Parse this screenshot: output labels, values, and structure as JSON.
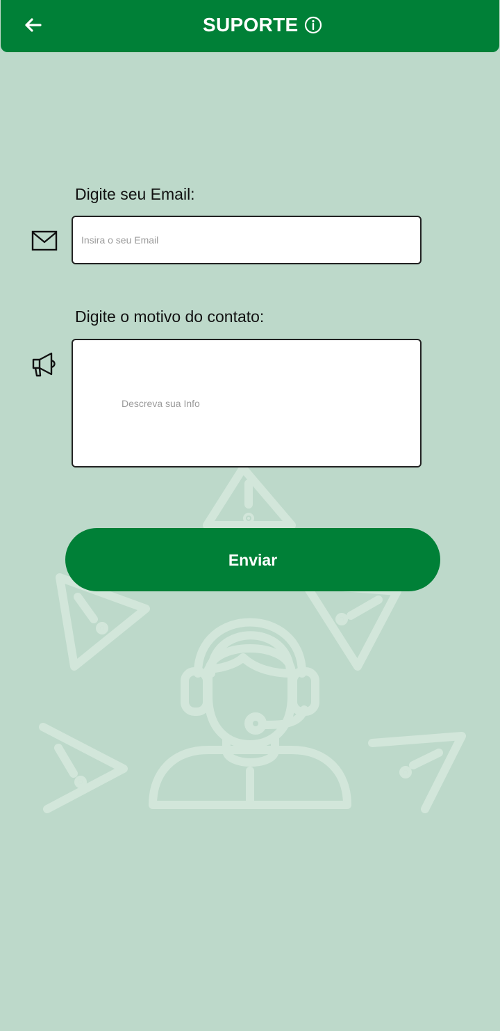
{
  "header": {
    "title": "SUPORTE",
    "back_icon": "arrow-left-icon",
    "info_icon": "info-circle-icon"
  },
  "form": {
    "email": {
      "label": "Digite seu Email:",
      "placeholder": "Insira o seu Email",
      "value": "",
      "icon": "envelope-icon"
    },
    "reason": {
      "label": "Digite o motivo do contato:",
      "placeholder": "Descreva sua Info",
      "value": "",
      "icon": "megaphone-icon"
    },
    "submit_label": "Enviar"
  },
  "background": {
    "illustration": "support-agent-headset-with-warning-triangles"
  },
  "colors": {
    "brand_green": "#008037",
    "background": "#bdd9ca",
    "illustration_stroke": "#d2e6da"
  }
}
